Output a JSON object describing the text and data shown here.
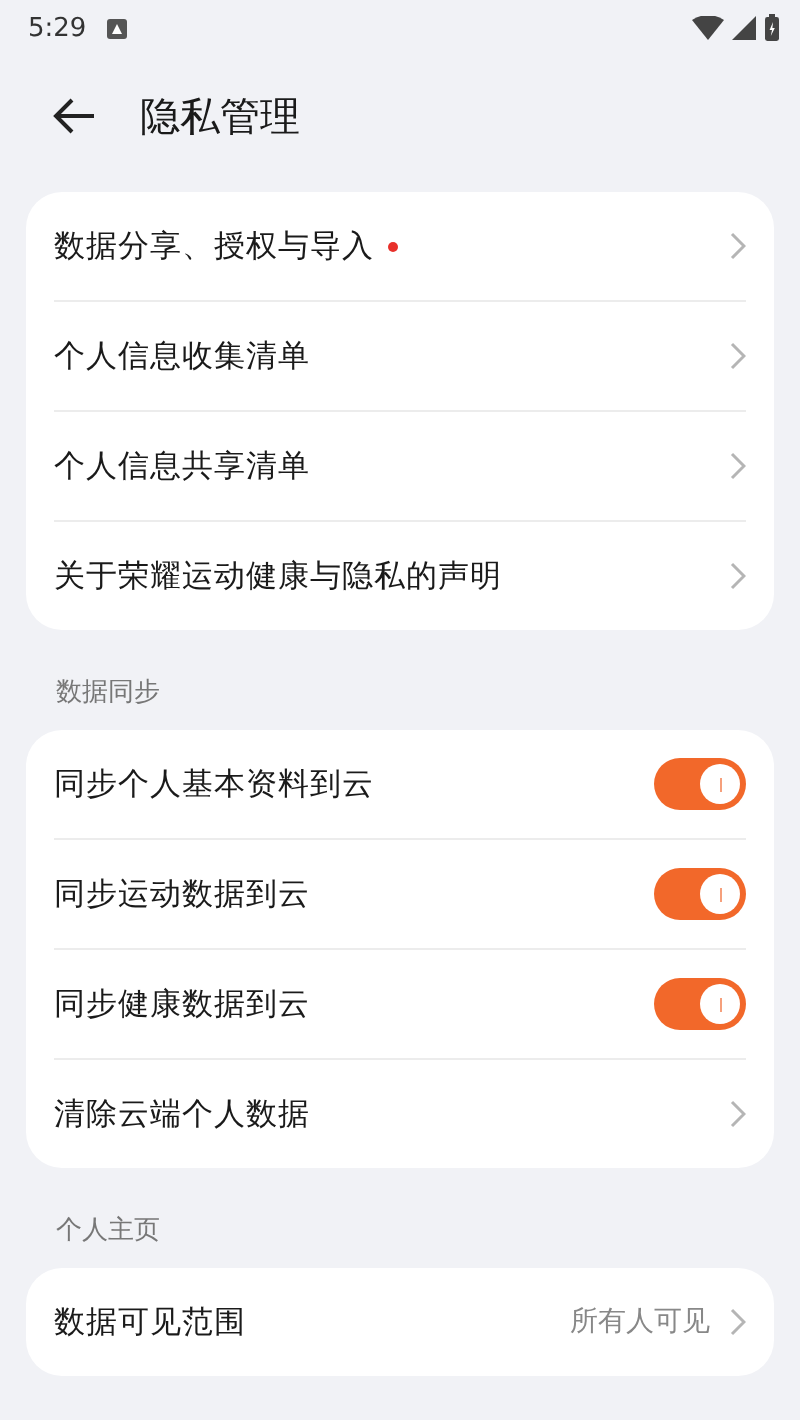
{
  "status_bar": {
    "time": "5:29"
  },
  "header": {
    "title": "隐私管理"
  },
  "sections": [
    {
      "items": [
        {
          "kind": "link",
          "label": "数据分享、授权与导入",
          "badge": true
        },
        {
          "kind": "link",
          "label": "个人信息收集清单",
          "badge": false
        },
        {
          "kind": "link",
          "label": "个人信息共享清单",
          "badge": false
        },
        {
          "kind": "link",
          "label": "关于荣耀运动健康与隐私的声明",
          "badge": false
        }
      ]
    },
    {
      "title": "数据同步",
      "items": [
        {
          "kind": "toggle",
          "label": "同步个人基本资料到云",
          "on": true
        },
        {
          "kind": "toggle",
          "label": "同步运动数据到云",
          "on": true
        },
        {
          "kind": "toggle",
          "label": "同步健康数据到云",
          "on": true
        },
        {
          "kind": "link",
          "label": "清除云端个人数据",
          "badge": false
        }
      ]
    },
    {
      "title": "个人主页",
      "items": [
        {
          "kind": "link",
          "label": "数据可见范围",
          "value": "所有人可见",
          "badge": false
        }
      ]
    }
  ]
}
